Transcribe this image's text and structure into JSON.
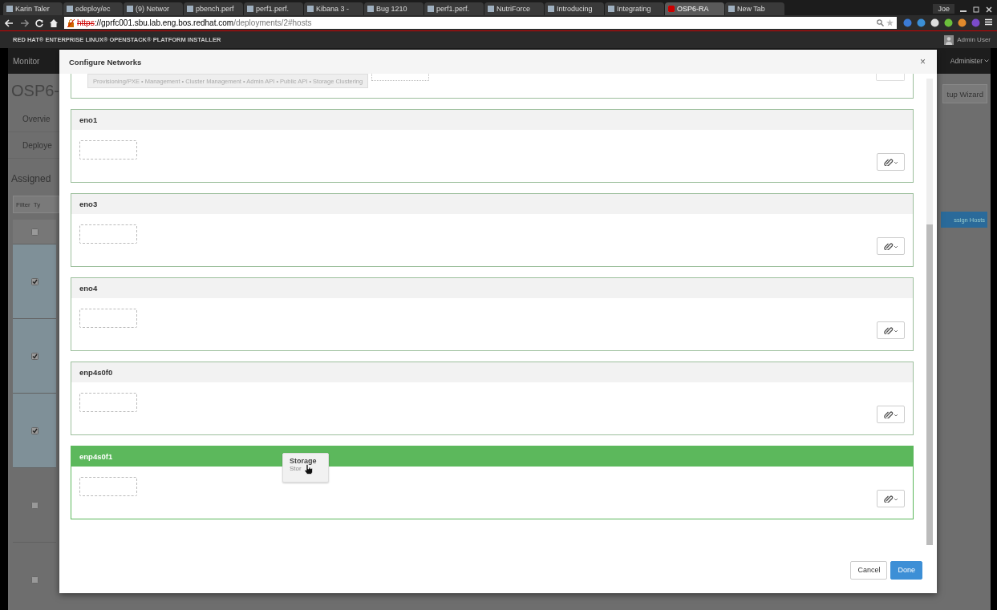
{
  "browser": {
    "tabs": [
      {
        "label": "Karin Taler",
        "selected": false
      },
      {
        "label": "edeploy/ec",
        "selected": false
      },
      {
        "label": "(9) Networ",
        "selected": false
      },
      {
        "label": "pbench.perf",
        "selected": false
      },
      {
        "label": "perf1.perf.",
        "selected": false
      },
      {
        "label": "Kibana 3 -",
        "selected": false
      },
      {
        "label": "Bug 1210",
        "selected": false
      },
      {
        "label": "perf1.perf.",
        "selected": false
      },
      {
        "label": "NutriForce",
        "selected": false
      },
      {
        "label": "Introducing",
        "selected": false
      },
      {
        "label": "Integrating",
        "selected": false
      },
      {
        "label": "OSP6-RA",
        "selected": true
      },
      {
        "label": "New Tab",
        "selected": false
      }
    ],
    "profile": "Joe",
    "url_scheme": "https",
    "url_rest": "://gprfc001.sbu.lab.eng.bos.redhat.com",
    "url_path": "/deployments/2#hosts"
  },
  "product_bar": {
    "title": "RED HAT® ENTERPRISE LINUX® OPENSTACK® PLATFORM INSTALLER",
    "user": "Admin User"
  },
  "background": {
    "nav_left": "Monitor",
    "nav_right": "Administer",
    "page_title": "OSP6-",
    "page_tabs": [
      "Overvie",
      "Deploye"
    ],
    "section": "Assigned",
    "filter": "Filter",
    "filter_type": "Ty",
    "wizard_button": "tup Wizard",
    "assign_button": "ssign Hosts",
    "rows": [
      {
        "kind": "header",
        "checked": false
      },
      {
        "kind": "host",
        "checked": true
      },
      {
        "kind": "host",
        "checked": true
      },
      {
        "kind": "host",
        "checked": true
      },
      {
        "kind": "host",
        "checked": false
      },
      {
        "kind": "host",
        "checked": false
      }
    ]
  },
  "modal": {
    "title": "Configure Networks",
    "close": "×",
    "top_chips": "Provisioning/PXE • Management • Cluster Management • Admin API • Public API • Storage Clustering",
    "interfaces": [
      {
        "name": "eno1",
        "highlighted": false
      },
      {
        "name": "eno3",
        "highlighted": false
      },
      {
        "name": "eno4",
        "highlighted": false
      },
      {
        "name": "enp4s0f0",
        "highlighted": false
      },
      {
        "name": "enp4s0f1",
        "highlighted": true
      }
    ],
    "drag_chip": {
      "title": "Storage",
      "subtitle": "Stor"
    },
    "buttons": [
      {
        "label": "Cancel",
        "kind": "default"
      },
      {
        "label": "Done",
        "kind": "primary"
      }
    ]
  }
}
